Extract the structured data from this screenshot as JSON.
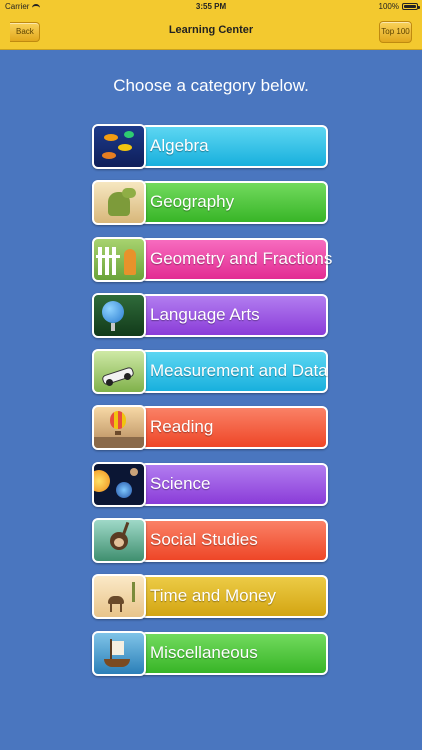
{
  "status": {
    "carrier": "Carrier",
    "time": "3:55 PM",
    "battery": "100%"
  },
  "nav": {
    "back_label": "Back",
    "title": "Learning Center",
    "top100_label": "Top 100"
  },
  "prompt": "Choose a category below.",
  "categories": [
    {
      "label": "Algebra",
      "color": "#2cc1e8",
      "icon": "fish-reef-icon"
    },
    {
      "label": "Geography",
      "color": "#4cc63a",
      "icon": "dinosaur-icon"
    },
    {
      "label": "Geometry and Fractions",
      "color": "#ef3fa3",
      "icon": "giraffe-fence-icon"
    },
    {
      "label": "Language Arts",
      "color": "#9a50e0",
      "icon": "globe-icon"
    },
    {
      "label": "Measurement and Data",
      "color": "#2cc1e8",
      "icon": "car-icon"
    },
    {
      "label": "Reading",
      "color": "#f45c3f",
      "icon": "hot-air-balloon-icon"
    },
    {
      "label": "Science",
      "color": "#9a50e0",
      "icon": "planets-icon"
    },
    {
      "label": "Social Studies",
      "color": "#f45c3f",
      "icon": "monkey-icon"
    },
    {
      "label": "Time and Money",
      "color": "#ddb21f",
      "icon": "camel-desert-icon"
    },
    {
      "label": "Miscellaneous",
      "color": "#4cc63a",
      "icon": "ship-icon"
    }
  ]
}
